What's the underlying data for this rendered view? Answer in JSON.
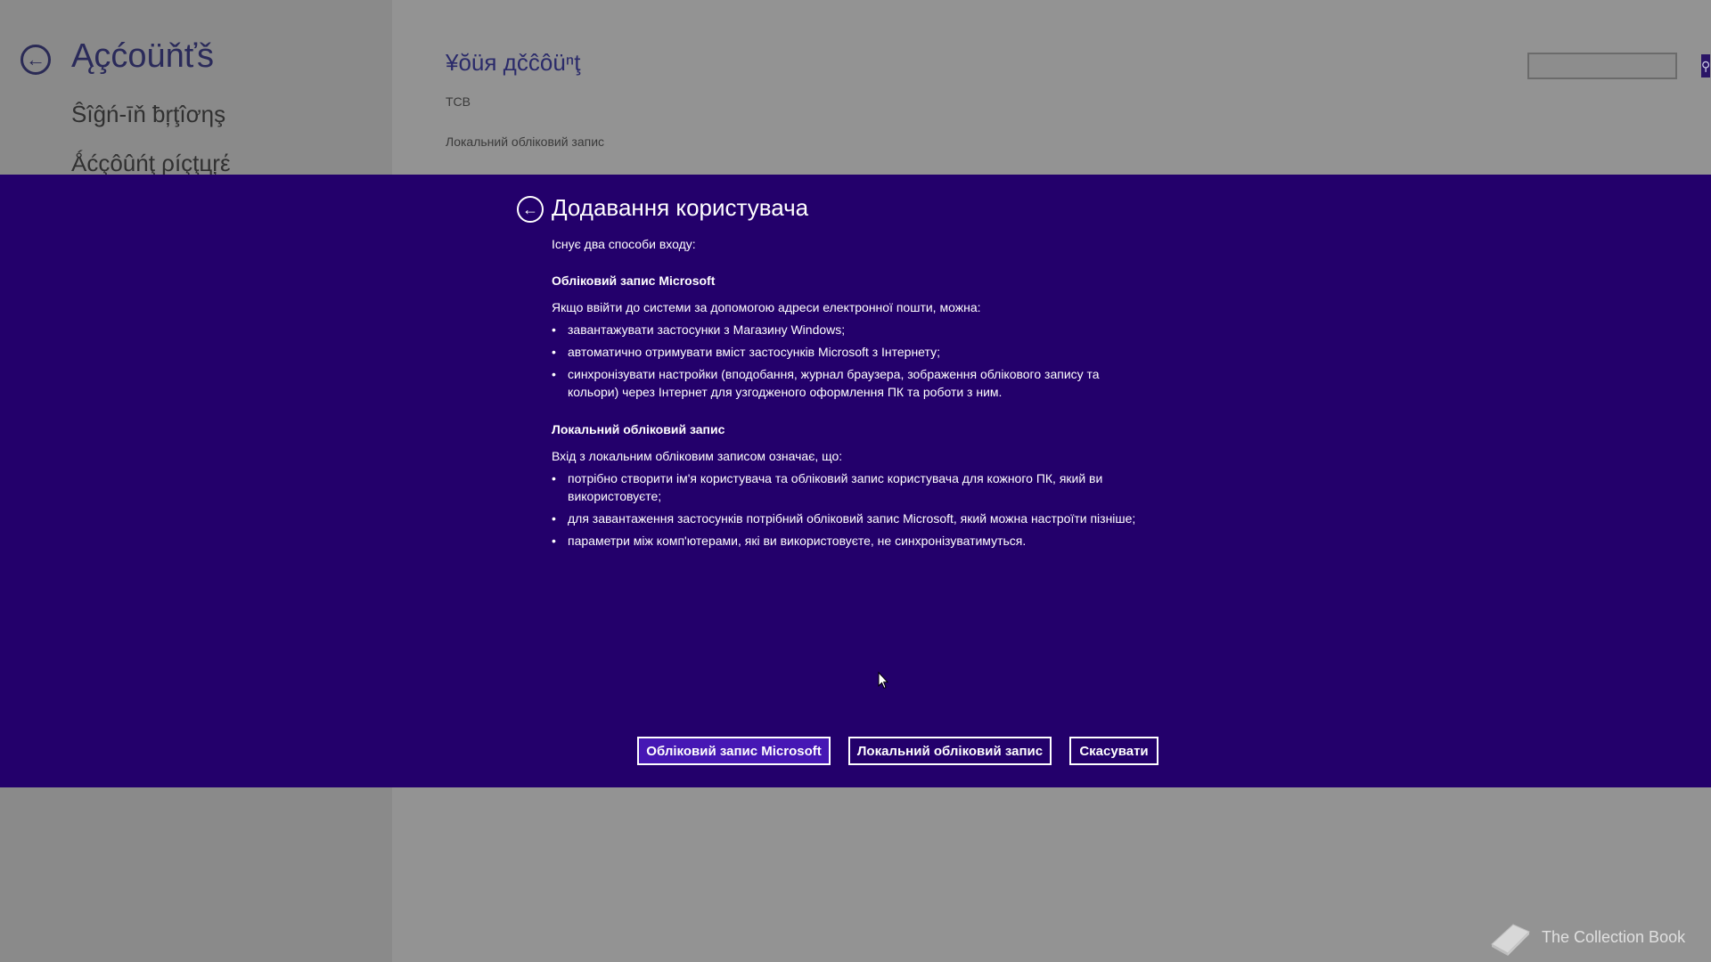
{
  "background": {
    "title": "Ąçćoüňťš",
    "nav": [
      "Ŝîĝń-īň ƀŗţîơηş",
      "Ǻćçôûńţ ρíçţцŗέ"
    ],
    "section_title": "¥ŏüя дčĉôüⁿţ",
    "user_name": "TCB",
    "account_type": "Локальний обліковий запис",
    "search": {
      "value": "",
      "placeholder": ""
    }
  },
  "dialog": {
    "title": "Додавання користувача",
    "intro": "Існує два способи входу:",
    "microsoft": {
      "heading": "Обліковий запис Microsoft",
      "lead": "Якщо ввійти до системи за допомогою адреси електронної пошти, можна:",
      "bullets": [
        "завантажувати застосунки з Магазину Windows;",
        "автоматично отримувати вміст застосунків Microsoft з Інтернету;",
        "синхронізувати настройки (вподобання, журнал браузера, зображення облікового запису та кольори) через Інтернет для узгодженого оформлення ПК та роботи з ним."
      ]
    },
    "local": {
      "heading": "Локальний обліковий запис",
      "lead": "Вхід з локальним обліковим записом означає, що:",
      "bullets": [
        "потрібно створити ім'я користувача та обліковий запис користувача для кожного ПК, який ви використовуєте;",
        "для завантаження застосунків потрібний обліковий запис Microsoft, який можна настроїти пізніше;",
        "параметри між комп'ютерами, які ви використовуєте, не синхронізуватимуться."
      ]
    },
    "buttons": {
      "microsoft": "Обліковий запис Microsoft",
      "local": "Локальний обліковий запис",
      "cancel": "Скасувати"
    }
  },
  "watermark": "The Collection Book",
  "colors": {
    "dialog_bg": "#23006b",
    "primary_button": "#4617b4",
    "background_dim": "#909090"
  }
}
